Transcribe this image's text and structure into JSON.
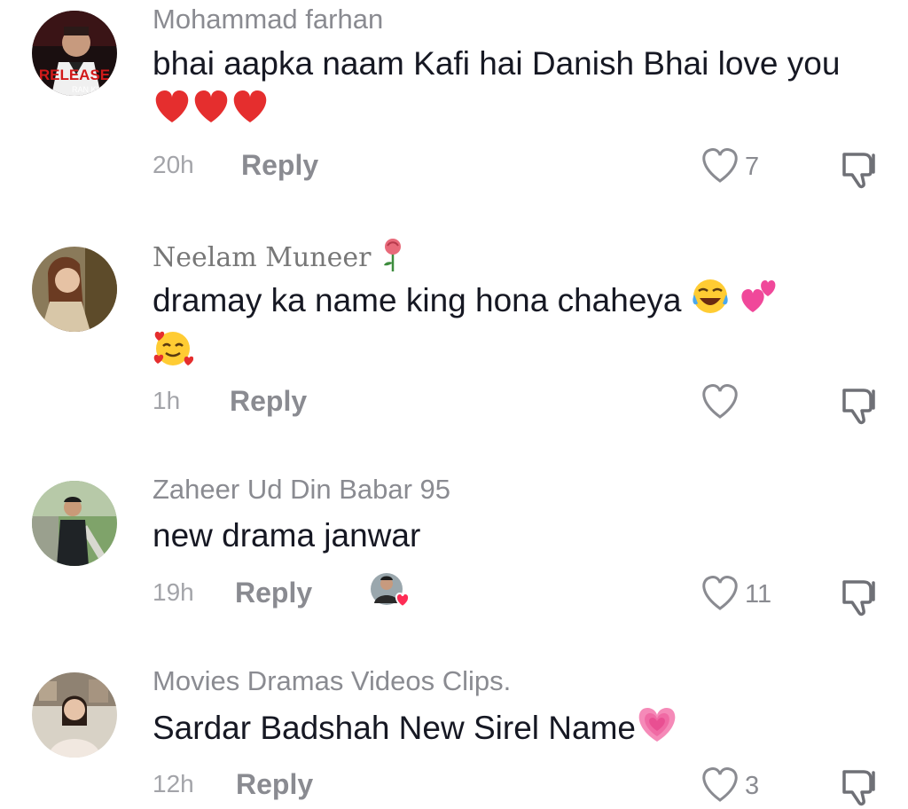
{
  "comments": [
    {
      "username": "Mohammad farhan",
      "avatar_text": "RELEASE",
      "text": "bhai aapka naam Kafi hai Danish Bhai love you",
      "emojis": "heart-emoji heart-emoji heart-emoji",
      "time": "20h",
      "reply": "Reply",
      "likes": "7"
    },
    {
      "username": "Neelam Muneer",
      "username_emoji": "rose-emoji",
      "text": "dramay ka name king hona chaheya",
      "emojis": "tears-of-joy-emoji two-hearts-emoji smiling-face-with-hearts-emoji",
      "time": "1h",
      "reply": "Reply",
      "likes": ""
    },
    {
      "username": "Zaheer Ud Din Babar 95",
      "text": "new drama janwar",
      "time": "19h",
      "reply": "Reply",
      "likes": "11"
    },
    {
      "username": "Movies Dramas Videos Clips.",
      "text": "Sardar Badshah New Sirel Name",
      "emojis": "growing-heart-emoji",
      "time": "12h",
      "reply": "Reply",
      "likes": "3"
    }
  ],
  "colors": {
    "username": "#8a8b91",
    "text": "#161823",
    "heart_red": "#e52e2e",
    "liker_heart": "#fe2c55"
  }
}
